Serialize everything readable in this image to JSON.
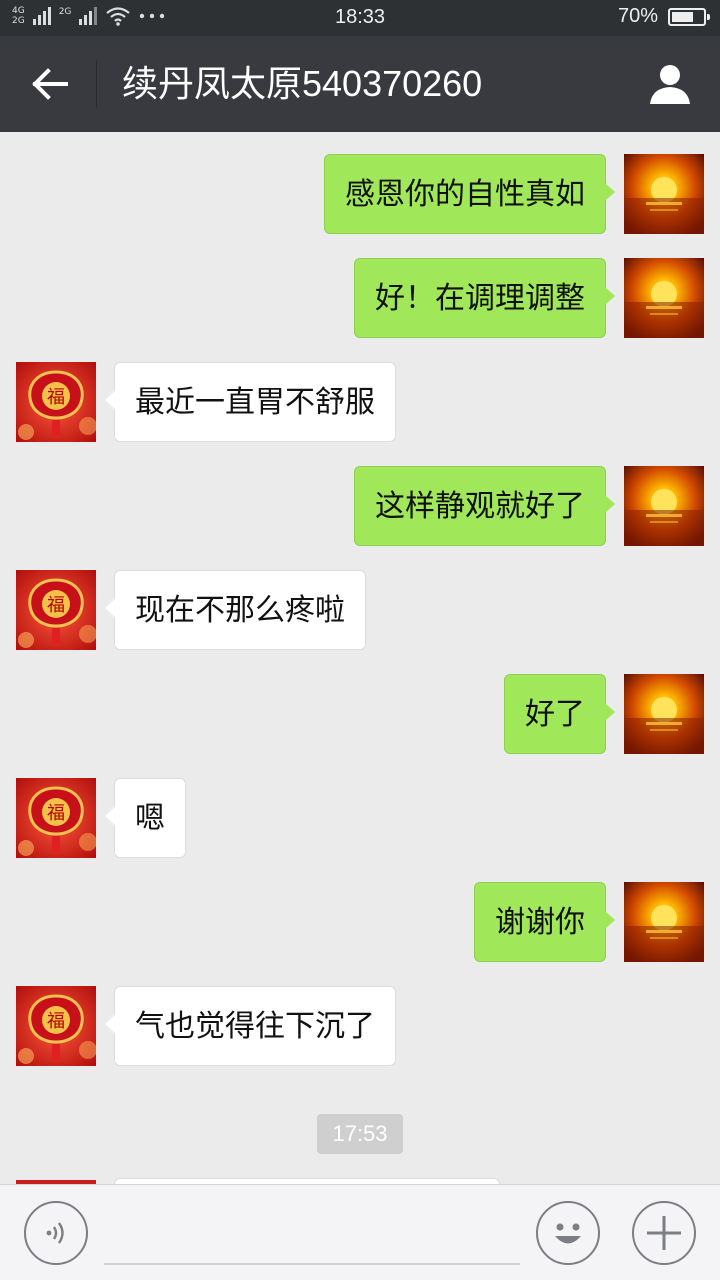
{
  "status_bar": {
    "network_1": "4G",
    "network_2": "2G",
    "network_3": "2G",
    "time": "18:33",
    "battery_percent": "70%",
    "battery_level": 0.7,
    "icons": [
      "signal-icon",
      "wifi-icon",
      "more-dots-icon",
      "battery-icon"
    ]
  },
  "header": {
    "title": "续丹凤太原540370260",
    "icons": [
      "back-arrow-icon",
      "profile-icon"
    ]
  },
  "messages": [
    {
      "dir": "out",
      "text": "感恩你的自性真如",
      "avatar": "sunset-avatar"
    },
    {
      "dir": "out",
      "text": "好！在调理调整",
      "avatar": "sunset-avatar"
    },
    {
      "dir": "in",
      "text": "最近一直胃不舒服",
      "avatar": "fu-avatar"
    },
    {
      "dir": "out",
      "text": "这样静观就好了",
      "avatar": "sunset-avatar"
    },
    {
      "dir": "in",
      "text": "现在不那么疼啦",
      "avatar": "fu-avatar"
    },
    {
      "dir": "out",
      "text": "好了",
      "avatar": "sunset-avatar"
    },
    {
      "dir": "in",
      "text": "嗯",
      "avatar": "fu-avatar"
    },
    {
      "dir": "out",
      "text": "谢谢你",
      "avatar": "sunset-avatar"
    },
    {
      "dir": "in",
      "text": "气也觉得往下沉了",
      "avatar": "fu-avatar"
    }
  ],
  "time_separator": "17:53",
  "input_bar": {
    "icons": [
      "voice-icon",
      "emoji-icon",
      "plus-icon"
    ],
    "input_value": "",
    "input_placeholder": ""
  },
  "colors": {
    "outgoing_bubble": "#a0e75a",
    "incoming_bubble": "#ffffff",
    "background": "#ebebeb",
    "header": "#393a3f",
    "status_bar": "#2e3133"
  }
}
